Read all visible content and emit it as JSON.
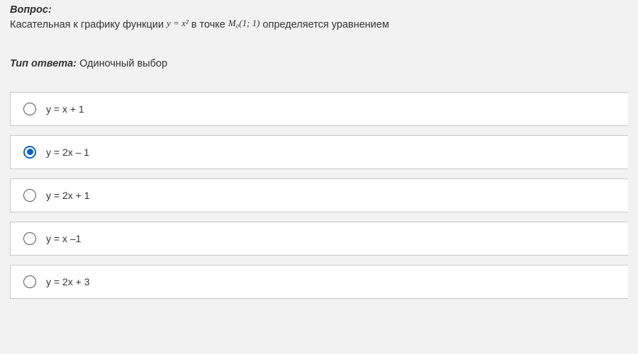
{
  "question": {
    "label": "Вопрос:",
    "text_part1": "Касательная к графику функции ",
    "formula1": "y = x²",
    "text_part2": " в точке ",
    "formula2": "M₀(1; 1)",
    "text_part3": "  определяется уравнением"
  },
  "answer_type": {
    "label": "Тип ответа:",
    "value": "Одиночный выбор"
  },
  "options": [
    {
      "text": "y = x + 1",
      "selected": false
    },
    {
      "text": "y = 2x – 1",
      "selected": true
    },
    {
      "text": "y = 2x + 1",
      "selected": false
    },
    {
      "text": "y = x –1",
      "selected": false
    },
    {
      "text": "y = 2x + 3",
      "selected": false
    }
  ]
}
